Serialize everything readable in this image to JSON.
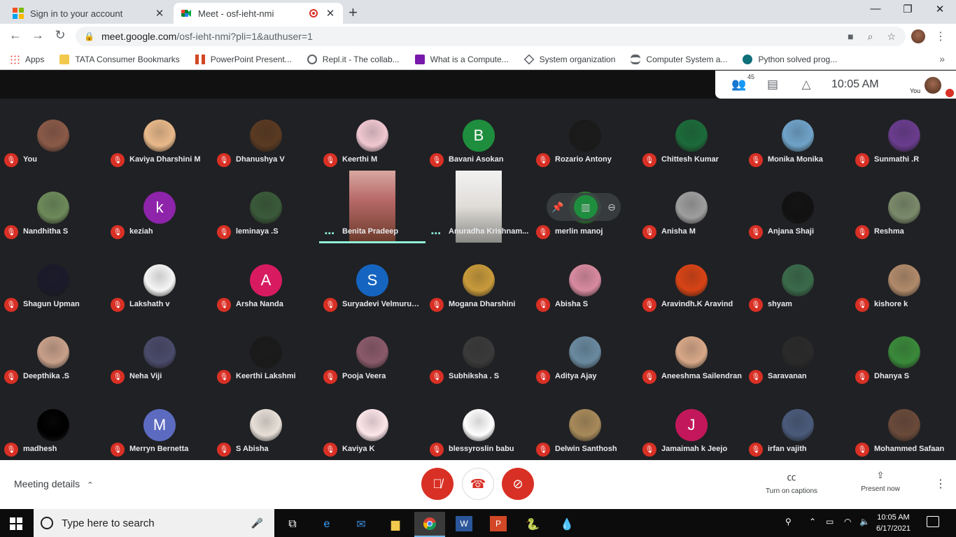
{
  "tabs": [
    {
      "title": "Sign in to your account",
      "active": false
    },
    {
      "title": "Meet - osf-ieht-nmi",
      "active": true
    }
  ],
  "address": {
    "host": "meet.google.com",
    "path": "/osf-ieht-nmi?pli=1&authuser=1"
  },
  "bookmarks": [
    {
      "label": "Apps",
      "icon": "apps-grid-icon"
    },
    {
      "label": "TATA Consumer Bookmarks",
      "icon": "folder-icon"
    },
    {
      "label": "PowerPoint Present...",
      "icon": "powerpoint-icon"
    },
    {
      "label": "Repl.it - The collab...",
      "icon": "replit-icon"
    },
    {
      "label": "What is a Compute...",
      "icon": "onenote-icon"
    },
    {
      "label": "System organization",
      "icon": "diamond-icon"
    },
    {
      "label": "Computer System a...",
      "icon": "hat-icon"
    },
    {
      "label": "Python solved prog...",
      "icon": "python-icon"
    }
  ],
  "meet": {
    "participant_count": "45",
    "time": "10:05  AM",
    "you_label": "You",
    "participants": [
      {
        "name": "You",
        "avatar": "photo",
        "color": "#8a5a48"
      },
      {
        "name": "Kaviya Dharshini M",
        "avatar": "photo",
        "color": "#e9b98a"
      },
      {
        "name": "Dhanushya V",
        "avatar": "photo",
        "color": "#5a3a22"
      },
      {
        "name": "Keerthi M",
        "avatar": "photo",
        "color": "#f0c8d2"
      },
      {
        "name": "Bavani Asokan",
        "avatar": "B",
        "color": "#1e8e3e"
      },
      {
        "name": "Rozario Antony",
        "avatar": "photo",
        "color": "#1a1a1a"
      },
      {
        "name": "Chittesh Kumar",
        "avatar": "photo",
        "color": "#1c6b3a"
      },
      {
        "name": "Monika Monika",
        "avatar": "photo",
        "color": "#6fa3c8"
      },
      {
        "name": "Sunmathi .R",
        "avatar": "photo",
        "color": "#6a3c8e"
      },
      {
        "name": "Nandhitha S",
        "avatar": "photo",
        "color": "#6d8a5a"
      },
      {
        "name": "keziah",
        "avatar": "k",
        "color": "#8e24aa"
      },
      {
        "name": "leminaya .S",
        "avatar": "photo",
        "color": "#3a5a3a"
      },
      {
        "name": "Benita Pradeep",
        "avatar": "video",
        "color": "#b86a6a"
      },
      {
        "name": "Anuradha Krishnam...",
        "avatar": "video",
        "color": "#e0dcd8"
      },
      {
        "name": "merlin manoj",
        "avatar": "photo",
        "color": "#2e7d32"
      },
      {
        "name": "Anisha M",
        "avatar": "photo",
        "color": "#9e9e9e"
      },
      {
        "name": "Anjana Shaji",
        "avatar": "photo",
        "color": "#111111"
      },
      {
        "name": "Reshma",
        "avatar": "photo",
        "color": "#7a8a6a"
      },
      {
        "name": "Shagun Upman",
        "avatar": "photo",
        "color": "#1a1a2a"
      },
      {
        "name": "Lakshath v",
        "avatar": "photo",
        "color": "#f5f5f5"
      },
      {
        "name": "Arsha Nanda",
        "avatar": "A",
        "color": "#d81b60"
      },
      {
        "name": "Suryadevi Velmurugan",
        "avatar": "S",
        "color": "#1565c0"
      },
      {
        "name": "Mogana Dharshini",
        "avatar": "photo",
        "color": "#c89a3a"
      },
      {
        "name": "Abisha S",
        "avatar": "photo",
        "color": "#d88aa0"
      },
      {
        "name": "Aravindh.K Aravind",
        "avatar": "photo",
        "color": "#d84315"
      },
      {
        "name": "shyam",
        "avatar": "photo",
        "color": "#3a6a4a"
      },
      {
        "name": "kishore k",
        "avatar": "photo",
        "color": "#b08a6a"
      },
      {
        "name": "Deepthika .S",
        "avatar": "photo",
        "color": "#c8a08a"
      },
      {
        "name": "Neha Viji",
        "avatar": "photo",
        "color": "#4a4a6a"
      },
      {
        "name": "Keerthi Lakshmi",
        "avatar": "photo",
        "color": "#1a1a1a"
      },
      {
        "name": "Pooja Veera",
        "avatar": "photo",
        "color": "#8a5a6a"
      },
      {
        "name": "Subhiksha . S",
        "avatar": "photo",
        "color": "#3a3a3a"
      },
      {
        "name": "Aditya Ajay",
        "avatar": "photo",
        "color": "#6a8aa0"
      },
      {
        "name": "Aneeshma Sailendran",
        "avatar": "photo",
        "color": "#d8a888"
      },
      {
        "name": "Saravanan",
        "avatar": "photo",
        "color": "#2a2a2a"
      },
      {
        "name": "Dhanya S",
        "avatar": "photo",
        "color": "#3a8a3a"
      },
      {
        "name": "madhesh",
        "avatar": "photo",
        "color": "#000000"
      },
      {
        "name": "Merryn Bernetta",
        "avatar": "M",
        "color": "#5c6bc0"
      },
      {
        "name": "S Abisha",
        "avatar": "photo",
        "color": "#e8e0d8"
      },
      {
        "name": "Kaviya K",
        "avatar": "photo",
        "color": "#fde6ea"
      },
      {
        "name": "blessyroslin babu",
        "avatar": "photo",
        "color": "#ffffff"
      },
      {
        "name": "Delwin Santhosh",
        "avatar": "photo",
        "color": "#a88a5a"
      },
      {
        "name": "Jamaimah k Jeejo",
        "avatar": "J",
        "color": "#c2185b"
      },
      {
        "name": "irfan vajith",
        "avatar": "photo",
        "color": "#4a5a7a"
      },
      {
        "name": "Mohammed Safaan",
        "avatar": "photo",
        "color": "#6a4a3a"
      }
    ]
  },
  "bottom": {
    "meeting_details": "Meeting details",
    "captions": "Turn on captions",
    "present": "Present now"
  },
  "taskbar": {
    "search_placeholder": "Type here to search",
    "time": "10:05 AM",
    "date": "6/17/2021",
    "apps": [
      "task-view-icon",
      "edge-icon",
      "mail-icon",
      "file-explorer-icon",
      "chrome-icon",
      "word-icon",
      "powerpoint-icon",
      "python-idle-icon",
      "paint3d-icon"
    ]
  }
}
